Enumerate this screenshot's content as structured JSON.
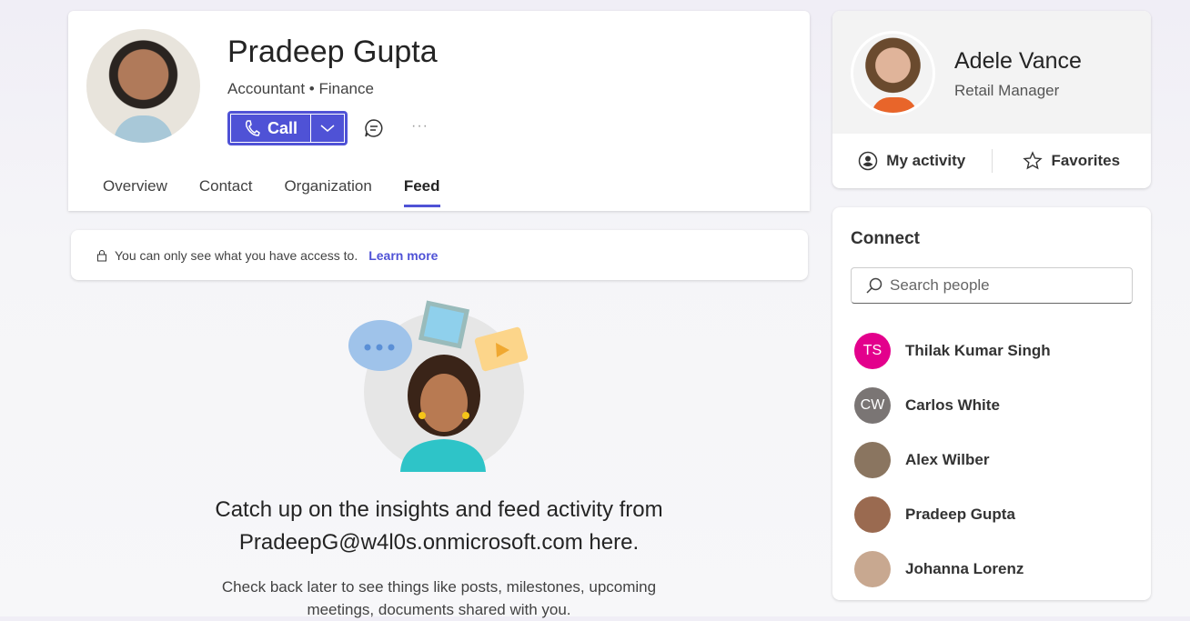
{
  "profile": {
    "name": "Pradeep Gupta",
    "role": "Accountant • Finance",
    "call_label": "Call",
    "more": "···",
    "tabs": [
      "Overview",
      "Contact",
      "Organization",
      "Feed"
    ],
    "active_tab": "Feed"
  },
  "notice": {
    "text": "You can only see what you have access to.",
    "link": "Learn more"
  },
  "feed": {
    "headline": "Catch up on the insights and feed activity from PradeepG@w4l0s.onmicrosoft.com here.",
    "sub": "Check back later to see things like posts, milestones, upcoming meetings, documents shared with you."
  },
  "me": {
    "name": "Adele Vance",
    "role": "Retail Manager",
    "my_activity": "My activity",
    "favorites": "Favorites"
  },
  "connect": {
    "title": "Connect",
    "search_placeholder": "Search people",
    "people": [
      {
        "initials": "TS",
        "name": "Thilak Kumar Singh",
        "color": "#e3008c"
      },
      {
        "initials": "CW",
        "name": "Carlos White",
        "color": "#7a7574"
      },
      {
        "initials": "",
        "name": "Alex Wilber",
        "color": "#8a7560"
      },
      {
        "initials": "",
        "name": "Pradeep Gupta",
        "color": "#9a6a50"
      },
      {
        "initials": "",
        "name": "Johanna Lorenz",
        "color": "#c8a890"
      }
    ]
  },
  "accent": "#4f52d6"
}
